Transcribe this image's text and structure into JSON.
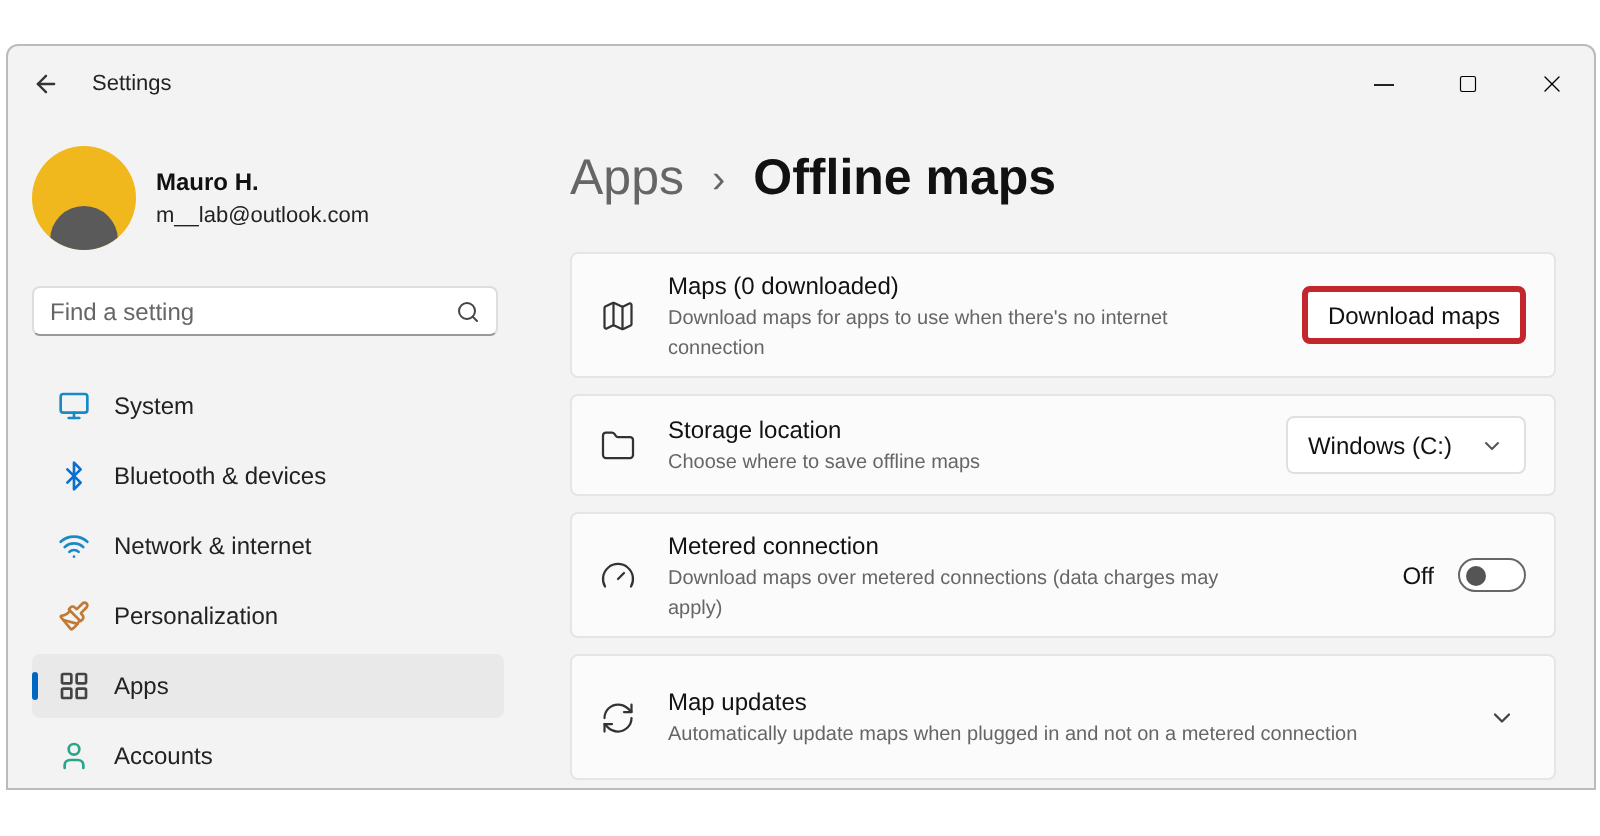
{
  "window": {
    "title": "Settings"
  },
  "user": {
    "name": "Mauro H.",
    "email": "m__lab@outlook.com"
  },
  "search": {
    "placeholder": "Find a setting"
  },
  "sidebar": {
    "items": [
      {
        "label": "System",
        "selected": false
      },
      {
        "label": "Bluetooth & devices",
        "selected": false
      },
      {
        "label": "Network & internet",
        "selected": false
      },
      {
        "label": "Personalization",
        "selected": false
      },
      {
        "label": "Apps",
        "selected": true
      },
      {
        "label": "Accounts",
        "selected": false
      }
    ]
  },
  "breadcrumb": {
    "parent": "Apps",
    "separator": "›",
    "current": "Offline maps"
  },
  "settings": [
    {
      "kind": "button",
      "title": "Maps (0 downloaded)",
      "description": "Download maps for apps to use when there's no internet connection",
      "action": "Download maps",
      "highlighted": true
    },
    {
      "kind": "dropdown",
      "title": "Storage location",
      "description": "Choose where to save offline maps",
      "value": "Windows (C:)"
    },
    {
      "kind": "toggle",
      "title": "Metered connection",
      "description": "Download maps over metered connections (data charges may apply)",
      "state_label": "Off",
      "on": false
    },
    {
      "kind": "expander",
      "title": "Map updates",
      "description": "Automatically update maps when plugged in and not on a metered connection",
      "expanded": false
    }
  ]
}
